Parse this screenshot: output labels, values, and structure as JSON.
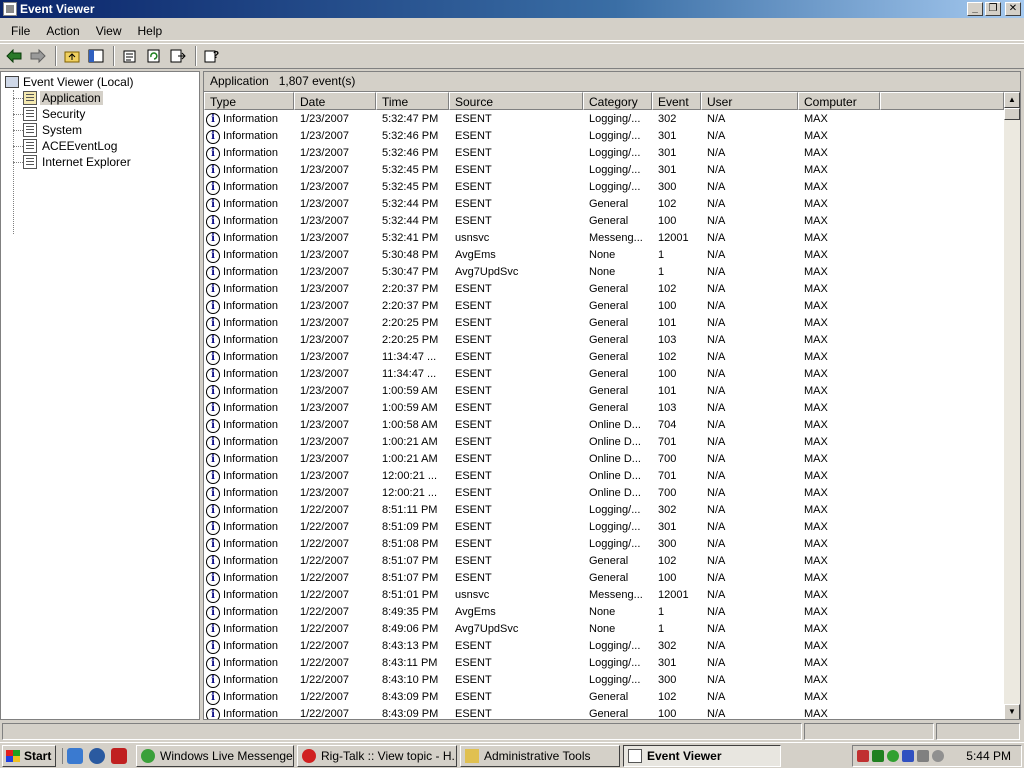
{
  "window": {
    "title": "Event Viewer"
  },
  "menu": [
    "File",
    "Action",
    "View",
    "Help"
  ],
  "toolbar_icons": [
    "back-arrow-icon",
    "forward-arrow-icon",
    "up-folder-icon",
    "show-hide-tree-icon",
    "properties-icon",
    "refresh-icon",
    "export-list-icon",
    "help-icon"
  ],
  "tree": {
    "root": "Event Viewer (Local)",
    "items": [
      {
        "label": "Application",
        "selected": true
      },
      {
        "label": "Security",
        "selected": false
      },
      {
        "label": "System",
        "selected": false
      },
      {
        "label": "ACEEventLog",
        "selected": false
      },
      {
        "label": "Internet Explorer",
        "selected": false
      }
    ]
  },
  "pane": {
    "log_name": "Application",
    "event_count": "1,807 event(s)"
  },
  "columns": [
    "Type",
    "Date",
    "Time",
    "Source",
    "Category",
    "Event",
    "User",
    "Computer"
  ],
  "events": [
    [
      "Information",
      "1/23/2007",
      "5:32:47 PM",
      "ESENT",
      "Logging/...",
      "302",
      "N/A",
      "MAX"
    ],
    [
      "Information",
      "1/23/2007",
      "5:32:46 PM",
      "ESENT",
      "Logging/...",
      "301",
      "N/A",
      "MAX"
    ],
    [
      "Information",
      "1/23/2007",
      "5:32:46 PM",
      "ESENT",
      "Logging/...",
      "301",
      "N/A",
      "MAX"
    ],
    [
      "Information",
      "1/23/2007",
      "5:32:45 PM",
      "ESENT",
      "Logging/...",
      "301",
      "N/A",
      "MAX"
    ],
    [
      "Information",
      "1/23/2007",
      "5:32:45 PM",
      "ESENT",
      "Logging/...",
      "300",
      "N/A",
      "MAX"
    ],
    [
      "Information",
      "1/23/2007",
      "5:32:44 PM",
      "ESENT",
      "General",
      "102",
      "N/A",
      "MAX"
    ],
    [
      "Information",
      "1/23/2007",
      "5:32:44 PM",
      "ESENT",
      "General",
      "100",
      "N/A",
      "MAX"
    ],
    [
      "Information",
      "1/23/2007",
      "5:32:41 PM",
      "usnsvc",
      "Messeng...",
      "12001",
      "N/A",
      "MAX"
    ],
    [
      "Information",
      "1/23/2007",
      "5:30:48 PM",
      "AvgEms",
      "None",
      "1",
      "N/A",
      "MAX"
    ],
    [
      "Information",
      "1/23/2007",
      "5:30:47 PM",
      "Avg7UpdSvc",
      "None",
      "1",
      "N/A",
      "MAX"
    ],
    [
      "Information",
      "1/23/2007",
      "2:20:37 PM",
      "ESENT",
      "General",
      "102",
      "N/A",
      "MAX"
    ],
    [
      "Information",
      "1/23/2007",
      "2:20:37 PM",
      "ESENT",
      "General",
      "100",
      "N/A",
      "MAX"
    ],
    [
      "Information",
      "1/23/2007",
      "2:20:25 PM",
      "ESENT",
      "General",
      "101",
      "N/A",
      "MAX"
    ],
    [
      "Information",
      "1/23/2007",
      "2:20:25 PM",
      "ESENT",
      "General",
      "103",
      "N/A",
      "MAX"
    ],
    [
      "Information",
      "1/23/2007",
      "11:34:47 ...",
      "ESENT",
      "General",
      "102",
      "N/A",
      "MAX"
    ],
    [
      "Information",
      "1/23/2007",
      "11:34:47 ...",
      "ESENT",
      "General",
      "100",
      "N/A",
      "MAX"
    ],
    [
      "Information",
      "1/23/2007",
      "1:00:59 AM",
      "ESENT",
      "General",
      "101",
      "N/A",
      "MAX"
    ],
    [
      "Information",
      "1/23/2007",
      "1:00:59 AM",
      "ESENT",
      "General",
      "103",
      "N/A",
      "MAX"
    ],
    [
      "Information",
      "1/23/2007",
      "1:00:58 AM",
      "ESENT",
      "Online D...",
      "704",
      "N/A",
      "MAX"
    ],
    [
      "Information",
      "1/23/2007",
      "1:00:21 AM",
      "ESENT",
      "Online D...",
      "701",
      "N/A",
      "MAX"
    ],
    [
      "Information",
      "1/23/2007",
      "1:00:21 AM",
      "ESENT",
      "Online D...",
      "700",
      "N/A",
      "MAX"
    ],
    [
      "Information",
      "1/23/2007",
      "12:00:21 ...",
      "ESENT",
      "Online D...",
      "701",
      "N/A",
      "MAX"
    ],
    [
      "Information",
      "1/23/2007",
      "12:00:21 ...",
      "ESENT",
      "Online D...",
      "700",
      "N/A",
      "MAX"
    ],
    [
      "Information",
      "1/22/2007",
      "8:51:11 PM",
      "ESENT",
      "Logging/...",
      "302",
      "N/A",
      "MAX"
    ],
    [
      "Information",
      "1/22/2007",
      "8:51:09 PM",
      "ESENT",
      "Logging/...",
      "301",
      "N/A",
      "MAX"
    ],
    [
      "Information",
      "1/22/2007",
      "8:51:08 PM",
      "ESENT",
      "Logging/...",
      "300",
      "N/A",
      "MAX"
    ],
    [
      "Information",
      "1/22/2007",
      "8:51:07 PM",
      "ESENT",
      "General",
      "102",
      "N/A",
      "MAX"
    ],
    [
      "Information",
      "1/22/2007",
      "8:51:07 PM",
      "ESENT",
      "General",
      "100",
      "N/A",
      "MAX"
    ],
    [
      "Information",
      "1/22/2007",
      "8:51:01 PM",
      "usnsvc",
      "Messeng...",
      "12001",
      "N/A",
      "MAX"
    ],
    [
      "Information",
      "1/22/2007",
      "8:49:35 PM",
      "AvgEms",
      "None",
      "1",
      "N/A",
      "MAX"
    ],
    [
      "Information",
      "1/22/2007",
      "8:49:06 PM",
      "Avg7UpdSvc",
      "None",
      "1",
      "N/A",
      "MAX"
    ],
    [
      "Information",
      "1/22/2007",
      "8:43:13 PM",
      "ESENT",
      "Logging/...",
      "302",
      "N/A",
      "MAX"
    ],
    [
      "Information",
      "1/22/2007",
      "8:43:11 PM",
      "ESENT",
      "Logging/...",
      "301",
      "N/A",
      "MAX"
    ],
    [
      "Information",
      "1/22/2007",
      "8:43:10 PM",
      "ESENT",
      "Logging/...",
      "300",
      "N/A",
      "MAX"
    ],
    [
      "Information",
      "1/22/2007",
      "8:43:09 PM",
      "ESENT",
      "General",
      "102",
      "N/A",
      "MAX"
    ],
    [
      "Information",
      "1/22/2007",
      "8:43:09 PM",
      "ESENT",
      "General",
      "100",
      "N/A",
      "MAX"
    ]
  ],
  "taskbar": {
    "start_label": "Start",
    "quick_launch": [
      "ie-icon",
      "media-player-icon",
      "app-icon"
    ],
    "tasks": [
      {
        "label": "Windows Live Messenger",
        "active": false,
        "icon": "messenger-icon"
      },
      {
        "label": "Rig-Talk :: View topic - H...",
        "active": false,
        "icon": "opera-icon"
      },
      {
        "label": "Administrative Tools",
        "active": false,
        "icon": "folder-icon"
      },
      {
        "label": "Event Viewer",
        "active": true,
        "icon": "event-viewer-icon"
      }
    ],
    "clock": "5:44 PM"
  },
  "colors": {
    "title_bar": "#0a246a",
    "window_bg": "#d4d0c8",
    "list_bg": "#ffffff"
  }
}
